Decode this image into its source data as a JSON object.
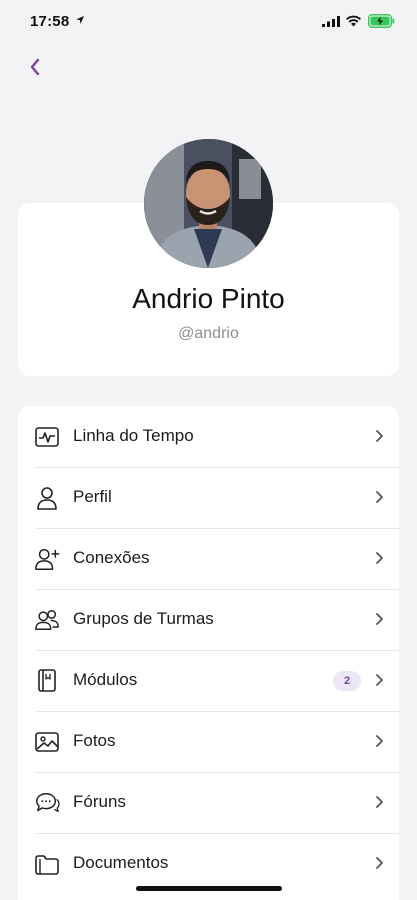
{
  "status_bar": {
    "time": "17:58"
  },
  "colors": {
    "accent": "#7b3fa6",
    "background": "#f3f3f5",
    "card": "#ffffff",
    "battery": "#35c759"
  },
  "profile": {
    "name": "Andrio Pinto",
    "handle": "@andrio"
  },
  "menu": {
    "items": [
      {
        "label": "Linha do Tempo",
        "icon": "activity-icon"
      },
      {
        "label": "Perfil",
        "icon": "user-icon"
      },
      {
        "label": "Conexões",
        "icon": "user-plus-icon"
      },
      {
        "label": "Grupos de Turmas",
        "icon": "users-icon"
      },
      {
        "label": "Módulos",
        "icon": "book-icon",
        "badge": "2"
      },
      {
        "label": "Fotos",
        "icon": "image-icon"
      },
      {
        "label": "Fóruns",
        "icon": "chat-icon"
      },
      {
        "label": "Documentos",
        "icon": "folder-icon"
      }
    ]
  }
}
